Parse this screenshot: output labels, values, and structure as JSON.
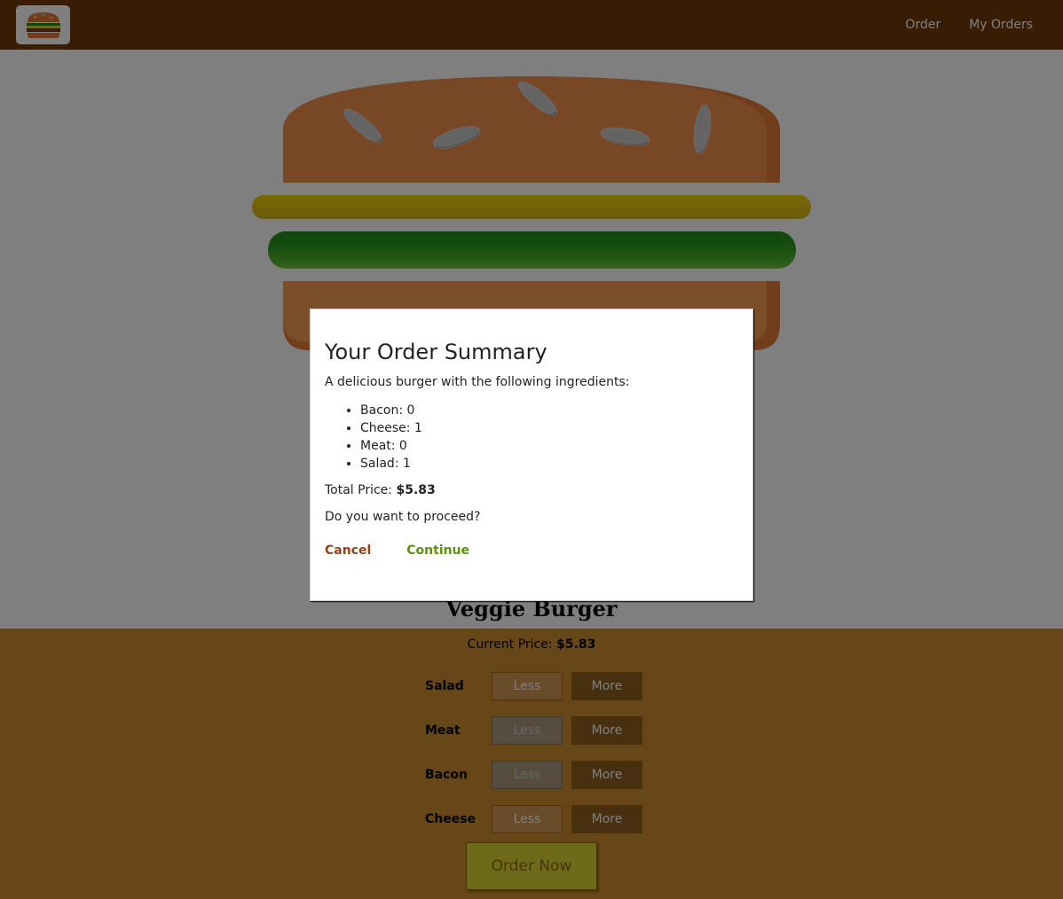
{
  "nav": {
    "order_label": "Order",
    "my_orders_label": "My Orders"
  },
  "burger": {
    "name": "Veggie Burger",
    "price_prefix": "Current Price: ",
    "price": "$5.83",
    "layers": [
      "cheese",
      "salad"
    ]
  },
  "controls": {
    "less_label": "Less",
    "more_label": "More",
    "rows": [
      {
        "label": "Salad",
        "less_disabled": false
      },
      {
        "label": "Meat",
        "less_disabled": true
      },
      {
        "label": "Bacon",
        "less_disabled": true
      },
      {
        "label": "Cheese",
        "less_disabled": false
      }
    ],
    "order_button": "Order Now"
  },
  "modal": {
    "title": "Your Order Summary",
    "intro": "A delicious burger with the following ingredients:",
    "ingredients": [
      "Bacon: 0",
      "Cheese: 1",
      "Meat: 0",
      "Salad: 1"
    ],
    "total_label": "Total Price: ",
    "total_value": "$5.83",
    "question": "Do you want to proceed?",
    "cancel_label": "Cancel",
    "continue_label": "Continue"
  },
  "colors": {
    "toolbar": "#703b09",
    "controls_bg": "#cf8f2e",
    "bread_top": "#e27b36",
    "cheese": "#f4d004",
    "salad": "#228c1d",
    "cancel": "#944317",
    "continue": "#5c9210"
  },
  "icons": {
    "logo": "burger-logo-icon"
  }
}
